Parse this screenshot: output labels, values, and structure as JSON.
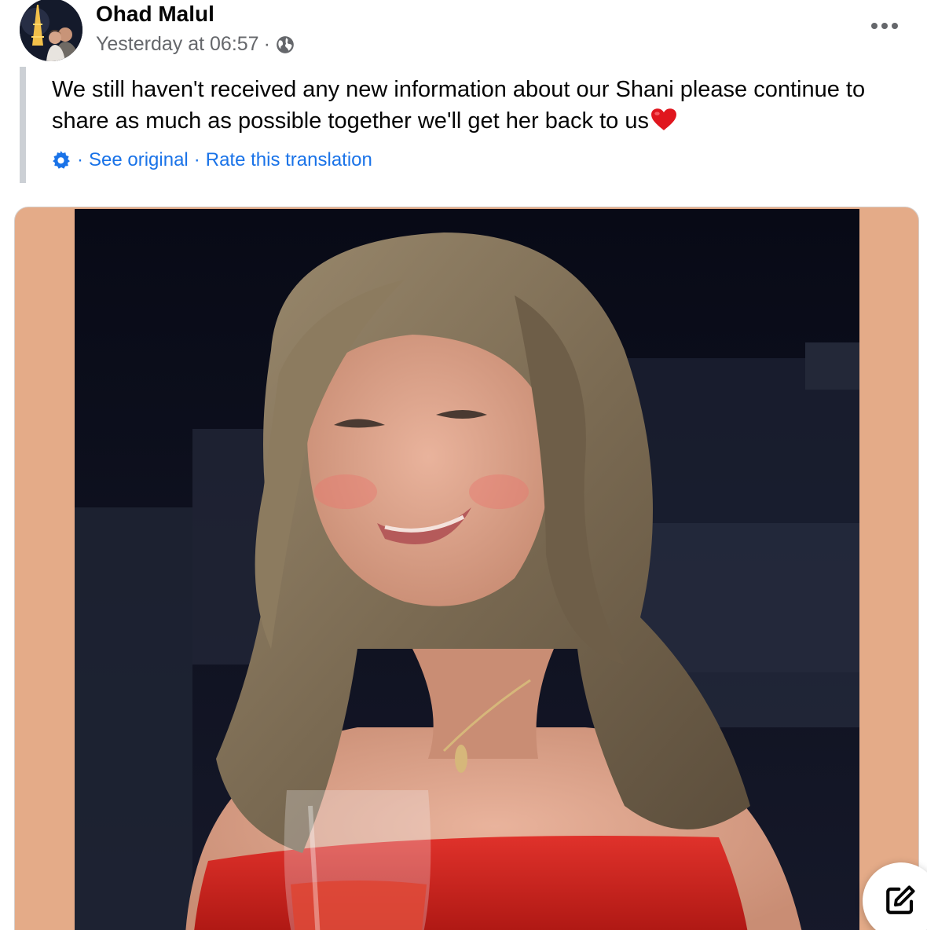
{
  "post": {
    "author": "Ohad Malul",
    "timestamp": "Yesterday at 06:57",
    "separator": "·",
    "audience_icon": "globe-icon",
    "more_icon": "more-options-icon",
    "text": "We still haven't received any new information about our Shani please continue to share as much as possible together we'll get her back to us",
    "emoji": "red-heart"
  },
  "translation": {
    "settings_icon": "gear-icon",
    "see_original": "See original",
    "rate": "Rate this translation",
    "separator": "·"
  },
  "photo": {
    "frame_color": "#e4ab88",
    "background_color": "#0d0f1c"
  },
  "actions": {
    "compose_icon": "edit-icon"
  },
  "colors": {
    "link": "#1a73e8",
    "meta": "#65676b",
    "text": "#050505"
  }
}
